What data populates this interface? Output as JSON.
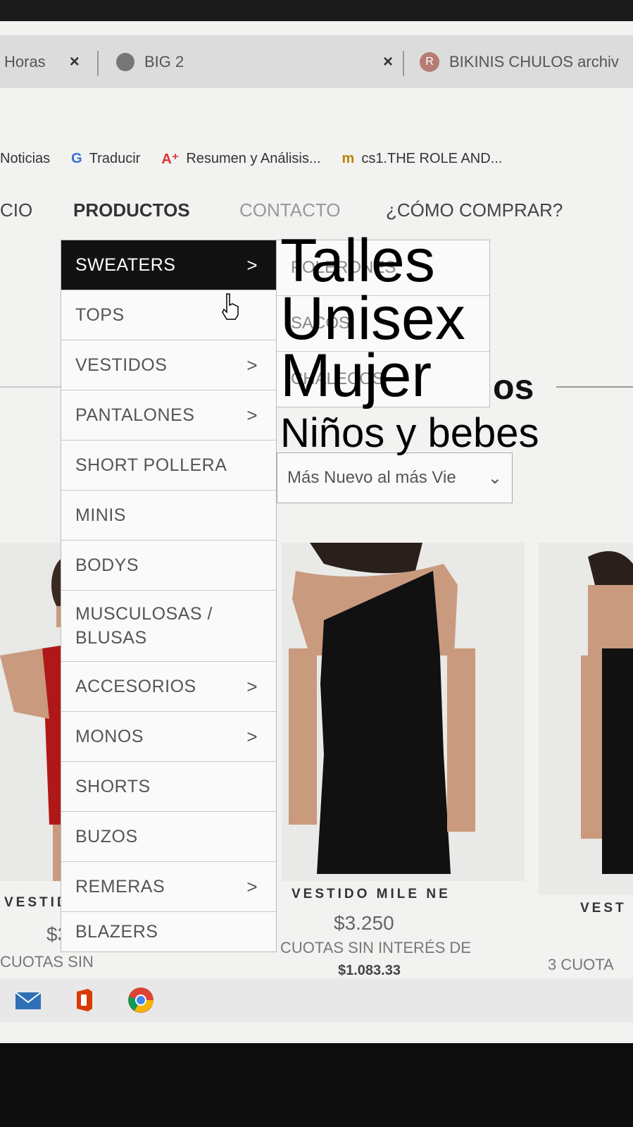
{
  "browser": {
    "tabs": [
      {
        "label": "Horas"
      },
      {
        "label": "BIG 2"
      },
      {
        "label": "BIKINIS CHULOS archiv"
      }
    ],
    "close_glyph": "×",
    "bookmarks": [
      {
        "label": "Noticias",
        "icon": "news-icon"
      },
      {
        "label": "Traducir",
        "icon": "translate-icon"
      },
      {
        "label": "Resumen y Análisis...",
        "icon": "font-icon"
      },
      {
        "label": "cs1.THE ROLE AND...",
        "icon": "m-icon"
      }
    ]
  },
  "site_nav": {
    "items": [
      "CIO",
      "PRODUCTOS",
      "CONTACTO",
      "¿CÓMO COMPRAR?"
    ]
  },
  "menu": {
    "items": [
      {
        "label": "SWEATERS",
        "arrow": ">"
      },
      {
        "label": "TOPS",
        "arrow": ""
      },
      {
        "label": "VESTIDOS",
        "arrow": ">"
      },
      {
        "label": "PANTALONES",
        "arrow": ">"
      },
      {
        "label": "SHORT POLLERA",
        "arrow": ""
      },
      {
        "label": "MINIS",
        "arrow": ""
      },
      {
        "label": "BODYS",
        "arrow": ""
      },
      {
        "label": "MUSCULOSAS / BLUSAS",
        "arrow": ""
      },
      {
        "label": "ACCESORIOS",
        "arrow": ">"
      },
      {
        "label": "MONOS",
        "arrow": ">"
      },
      {
        "label": "SHORTS",
        "arrow": ""
      },
      {
        "label": "BUZOS",
        "arrow": ""
      },
      {
        "label": "REMERAS",
        "arrow": ">"
      },
      {
        "label": "BLAZERS",
        "arrow": ""
      }
    ]
  },
  "submenu": {
    "items": [
      "POLERONES",
      "SACOS",
      "CHALECOS"
    ]
  },
  "overlay_text": {
    "line1": "Talles",
    "line2": "Unisex",
    "line3": "Mujer",
    "line4": "Niños y bebes"
  },
  "heading_tail": "os",
  "sort": {
    "value": "Más Nuevo al más Vie",
    "chevron": "⌄"
  },
  "products": [
    {
      "title": "VESTIDO",
      "price": "$3.",
      "cuotas": "CUOTAS SIN"
    },
    {
      "title": "VESTIDO MILE NE",
      "price": "$3.250",
      "cuotas": "CUOTAS SIN INTERÉS DE",
      "amount": "$1.083.33"
    },
    {
      "title": "VEST",
      "cuotas": "3 CUOTA"
    }
  ],
  "colors": {
    "menu_active_bg": "#121212",
    "dress_red": "#b01818",
    "dress_black": "#111111"
  }
}
